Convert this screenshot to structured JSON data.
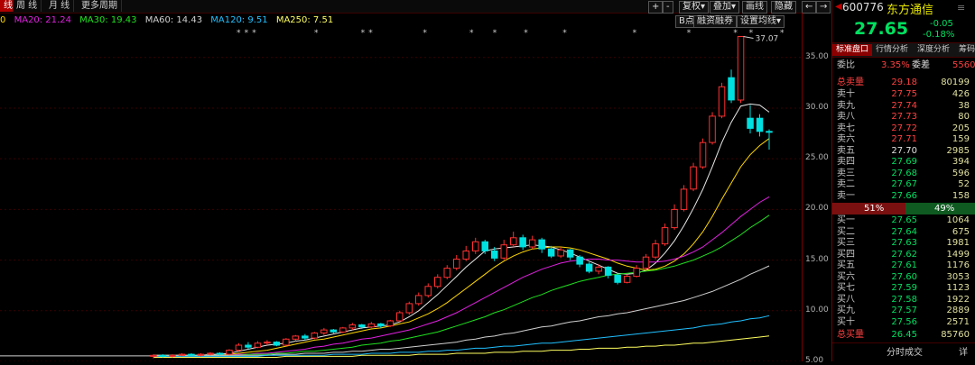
{
  "tabs": [
    "线",
    "周 线",
    "月 线",
    "更多周期"
  ],
  "toolbar": {
    "add": "+",
    "sub": "-",
    "left": "←",
    "right": "→",
    "b_point": "B点",
    "rights_label": "复权",
    "overlay_label": "叠加",
    "draw_label": "画线",
    "hide_label": "隐藏",
    "margin_label": "融资融券",
    "ma_settings_label": "设置均线"
  },
  "ma_legend": [
    {
      "label": "MA20: 21.24",
      "color": "#e020e0"
    },
    {
      "label": "MA30: 19.43",
      "color": "#20e020"
    },
    {
      "label": "MA60: 14.43",
      "color": "#d0d0d0"
    },
    {
      "label": "MA120: 9.51",
      "color": "#20c0ff"
    },
    {
      "label": "MA250: 7.51",
      "color": "#ffff60"
    }
  ],
  "ma_legend_first_visible": "0",
  "stock": {
    "code": "600776",
    "name": "东方通信",
    "price": "27.65",
    "change": "-0.05",
    "change_pct": "-0.18%"
  },
  "panel_tabs": [
    "标准盘口",
    "行情分析",
    "深度分析",
    "筹码"
  ],
  "ratio": {
    "label1": "委比",
    "value1": "3.35%",
    "label2": "委差",
    "value2": "5560"
  },
  "total_sell": {
    "label": "总卖量",
    "price": "29.18",
    "vol": "80199"
  },
  "asks": [
    {
      "label": "卖十",
      "price": "27.75",
      "vol": "426"
    },
    {
      "label": "卖九",
      "price": "27.74",
      "vol": "38"
    },
    {
      "label": "卖八",
      "price": "27.73",
      "vol": "80"
    },
    {
      "label": "卖七",
      "price": "27.72",
      "vol": "205"
    },
    {
      "label": "卖六",
      "price": "27.71",
      "vol": "159"
    },
    {
      "label": "卖五",
      "price": "27.70",
      "vol": "2985"
    },
    {
      "label": "卖四",
      "price": "27.69",
      "vol": "394"
    },
    {
      "label": "卖三",
      "price": "27.68",
      "vol": "596"
    },
    {
      "label": "卖二",
      "price": "27.67",
      "vol": "52"
    },
    {
      "label": "卖一",
      "price": "27.66",
      "vol": "158"
    }
  ],
  "ratio_bar": {
    "buy": "51%",
    "sell": "49%",
    "buy_frac": 0.51
  },
  "bids": [
    {
      "label": "买一",
      "price": "27.65",
      "vol": "1064"
    },
    {
      "label": "买二",
      "price": "27.64",
      "vol": "675"
    },
    {
      "label": "买三",
      "price": "27.63",
      "vol": "1981"
    },
    {
      "label": "买四",
      "price": "27.62",
      "vol": "1499"
    },
    {
      "label": "买五",
      "price": "27.61",
      "vol": "1176"
    },
    {
      "label": "买六",
      "price": "27.60",
      "vol": "3053"
    },
    {
      "label": "买七",
      "price": "27.59",
      "vol": "1123"
    },
    {
      "label": "买八",
      "price": "27.58",
      "vol": "1922"
    },
    {
      "label": "买九",
      "price": "27.57",
      "vol": "2889"
    },
    {
      "label": "买十",
      "price": "27.56",
      "vol": "2571"
    }
  ],
  "total_buy": {
    "label": "总买量",
    "price": "26.45",
    "vol": "85760"
  },
  "bottom_tabs": {
    "left": "分时成交",
    "right": "详"
  },
  "chart_data": {
    "type": "candlestick",
    "ylim": [
      5,
      38
    ],
    "yticks": [
      "35.00",
      "30.00",
      "25.00",
      "20.00",
      "15.00",
      "10.00",
      "5.00"
    ],
    "high_label": "37.07",
    "candles": [
      [
        5.5,
        5.6,
        5.3,
        5.7
      ],
      [
        5.6,
        5.5,
        5.4,
        5.7
      ],
      [
        5.5,
        5.6,
        5.4,
        5.7
      ],
      [
        5.6,
        5.7,
        5.5,
        5.8
      ],
      [
        5.7,
        5.6,
        5.5,
        5.8
      ],
      [
        5.6,
        5.7,
        5.5,
        5.8
      ],
      [
        5.7,
        5.8,
        5.6,
        5.9
      ],
      [
        5.8,
        5.7,
        5.6,
        5.9
      ],
      [
        5.7,
        6.1,
        5.6,
        6.2
      ],
      [
        6.1,
        6.6,
        6.0,
        6.8
      ],
      [
        6.6,
        6.4,
        6.2,
        6.9
      ],
      [
        6.4,
        6.8,
        6.3,
        7.0
      ],
      [
        6.8,
        6.9,
        6.6,
        7.1
      ],
      [
        6.9,
        6.6,
        6.5,
        7.0
      ],
      [
        6.6,
        7.2,
        6.5,
        7.3
      ],
      [
        7.2,
        7.5,
        7.0,
        7.6
      ],
      [
        7.5,
        7.3,
        7.1,
        7.7
      ],
      [
        7.3,
        7.8,
        7.2,
        7.9
      ],
      [
        7.8,
        8.1,
        7.6,
        8.3
      ],
      [
        8.1,
        7.9,
        7.7,
        8.2
      ],
      [
        7.9,
        8.3,
        7.8,
        8.4
      ],
      [
        8.3,
        8.6,
        8.1,
        8.8
      ],
      [
        8.6,
        8.4,
        8.2,
        8.7
      ],
      [
        8.4,
        8.7,
        8.3,
        8.9
      ],
      [
        8.7,
        8.5,
        8.3,
        8.8
      ],
      [
        8.5,
        9.0,
        8.4,
        9.1
      ],
      [
        9.0,
        9.8,
        8.9,
        10.0
      ],
      [
        9.8,
        10.7,
        9.6,
        10.9
      ],
      [
        10.7,
        11.5,
        10.5,
        11.8
      ],
      [
        11.5,
        12.4,
        11.3,
        12.7
      ],
      [
        12.4,
        13.3,
        12.2,
        13.6
      ],
      [
        13.3,
        14.2,
        13.1,
        14.5
      ],
      [
        14.2,
        15.1,
        14.0,
        15.5
      ],
      [
        15.1,
        15.9,
        14.9,
        16.4
      ],
      [
        15.9,
        16.8,
        15.6,
        17.2
      ],
      [
        16.8,
        15.9,
        15.6,
        17.0
      ],
      [
        15.9,
        15.2,
        14.9,
        16.3
      ],
      [
        15.2,
        16.5,
        15.0,
        17.0
      ],
      [
        16.5,
        17.2,
        16.2,
        17.8
      ],
      [
        17.2,
        16.3,
        16.0,
        17.5
      ],
      [
        16.3,
        17.0,
        16.1,
        17.4
      ],
      [
        17.0,
        16.1,
        15.7,
        17.2
      ],
      [
        16.1,
        15.4,
        15.2,
        16.4
      ],
      [
        15.4,
        16.0,
        15.2,
        16.3
      ],
      [
        16.0,
        15.3,
        15.0,
        16.1
      ],
      [
        15.3,
        14.6,
        14.3,
        15.5
      ],
      [
        14.6,
        13.9,
        13.7,
        14.8
      ],
      [
        13.9,
        14.3,
        13.6,
        14.6
      ],
      [
        14.3,
        13.5,
        13.2,
        14.4
      ],
      [
        13.5,
        12.8,
        12.6,
        13.7
      ],
      [
        12.8,
        13.4,
        12.7,
        13.6
      ],
      [
        13.4,
        14.2,
        13.3,
        14.5
      ],
      [
        14.2,
        15.3,
        14.0,
        15.6
      ],
      [
        15.3,
        16.6,
        15.1,
        17.0
      ],
      [
        16.6,
        18.2,
        16.4,
        18.6
      ],
      [
        18.2,
        20.0,
        18.0,
        20.5
      ],
      [
        20.0,
        22.0,
        19.8,
        22.4
      ],
      [
        22.0,
        24.2,
        21.8,
        24.6
      ],
      [
        24.2,
        26.6,
        24.0,
        27.0
      ],
      [
        26.6,
        29.2,
        26.4,
        29.6
      ],
      [
        29.2,
        32.1,
        29.0,
        32.5
      ],
      [
        33.0,
        30.8,
        30.5,
        33.8
      ],
      [
        30.8,
        37.07,
        30.5,
        37.07
      ],
      [
        29.0,
        28.0,
        27.5,
        30.3
      ],
      [
        29.0,
        27.7,
        27.2,
        29.4
      ],
      [
        27.7,
        27.65,
        25.9,
        27.9
      ]
    ],
    "ma_lines": [
      {
        "name": "MA5",
        "color": "#e8e8e8",
        "values": [
          5.6,
          5.6,
          5.6,
          5.6,
          5.6,
          5.6,
          5.7,
          5.7,
          5.8,
          6.0,
          6.2,
          6.4,
          6.6,
          6.7,
          6.8,
          7.0,
          7.1,
          7.3,
          7.5,
          7.7,
          7.9,
          8.1,
          8.3,
          8.4,
          8.5,
          8.6,
          8.9,
          9.4,
          10.0,
          10.8,
          11.6,
          12.5,
          13.4,
          14.3,
          15.1,
          15.9,
          16.1,
          16.2,
          16.3,
          16.4,
          16.5,
          16.4,
          16.3,
          16.0,
          15.7,
          15.3,
          14.9,
          14.5,
          14.1,
          13.7,
          13.6,
          13.7,
          14.0,
          14.7,
          15.7,
          16.9,
          18.4,
          20.1,
          22.0,
          24.2,
          26.6,
          28.6,
          30.2,
          30.4,
          30.3,
          29.6
        ]
      },
      {
        "name": "MA10",
        "color": "#ffd700",
        "values": [
          5.6,
          5.6,
          5.6,
          5.6,
          5.6,
          5.6,
          5.6,
          5.6,
          5.7,
          5.8,
          5.9,
          6.0,
          6.1,
          6.3,
          6.5,
          6.7,
          6.9,
          7.1,
          7.2,
          7.4,
          7.6,
          7.8,
          8.0,
          8.2,
          8.3,
          8.5,
          8.7,
          8.9,
          9.3,
          9.7,
          10.2,
          10.8,
          11.5,
          12.2,
          12.9,
          13.6,
          14.3,
          14.9,
          15.4,
          15.8,
          16.1,
          16.2,
          16.3,
          16.3,
          16.2,
          16.0,
          15.7,
          15.4,
          15.1,
          14.7,
          14.4,
          14.2,
          14.0,
          14.1,
          14.4,
          14.9,
          15.6,
          16.6,
          17.8,
          19.3,
          21.0,
          22.6,
          24.2,
          25.4,
          26.3,
          27.0
        ]
      },
      {
        "name": "MA20",
        "color": "#e020e0",
        "values": [
          5.6,
          5.6,
          5.6,
          5.6,
          5.6,
          5.6,
          5.6,
          5.6,
          5.6,
          5.7,
          5.7,
          5.8,
          5.8,
          5.9,
          6.0,
          6.1,
          6.2,
          6.4,
          6.5,
          6.7,
          6.8,
          7.0,
          7.2,
          7.3,
          7.5,
          7.7,
          7.9,
          8.1,
          8.4,
          8.7,
          9.0,
          9.4,
          9.8,
          10.3,
          10.8,
          11.3,
          11.8,
          12.3,
          12.8,
          13.3,
          13.7,
          14.1,
          14.4,
          14.7,
          14.9,
          15.0,
          15.1,
          15.1,
          15.0,
          15.0,
          14.9,
          14.8,
          14.8,
          14.8,
          14.9,
          15.1,
          15.4,
          15.8,
          16.3,
          17.0,
          17.7,
          18.5,
          19.3,
          20.0,
          20.7,
          21.24
        ]
      },
      {
        "name": "MA30",
        "color": "#20e020",
        "values": [
          5.6,
          5.6,
          5.6,
          5.6,
          5.6,
          5.6,
          5.6,
          5.6,
          5.6,
          5.6,
          5.7,
          5.7,
          5.7,
          5.8,
          5.8,
          5.9,
          6.0,
          6.0,
          6.1,
          6.2,
          6.3,
          6.4,
          6.6,
          6.7,
          6.8,
          7.0,
          7.1,
          7.3,
          7.5,
          7.7,
          7.9,
          8.2,
          8.5,
          8.8,
          9.1,
          9.4,
          9.8,
          10.1,
          10.5,
          10.9,
          11.3,
          11.6,
          12.0,
          12.3,
          12.6,
          12.9,
          13.1,
          13.3,
          13.5,
          13.6,
          13.7,
          13.8,
          13.9,
          14.0,
          14.2,
          14.4,
          14.7,
          15.0,
          15.4,
          15.8,
          16.3,
          16.9,
          17.5,
          18.2,
          18.8,
          19.43
        ]
      },
      {
        "name": "MA60",
        "color": "#d0d0d0",
        "values": [
          5.6,
          5.6,
          5.6,
          5.6,
          5.6,
          5.6,
          5.6,
          5.6,
          5.6,
          5.6,
          5.6,
          5.6,
          5.6,
          5.7,
          5.7,
          5.7,
          5.8,
          5.8,
          5.8,
          5.9,
          5.9,
          6.0,
          6.0,
          6.1,
          6.2,
          6.2,
          6.3,
          6.4,
          6.5,
          6.6,
          6.7,
          6.8,
          6.9,
          7.1,
          7.2,
          7.4,
          7.5,
          7.7,
          7.8,
          8.0,
          8.2,
          8.4,
          8.5,
          8.7,
          8.9,
          9.0,
          9.2,
          9.4,
          9.5,
          9.7,
          9.8,
          10.0,
          10.2,
          10.4,
          10.6,
          10.8,
          11.0,
          11.3,
          11.6,
          11.9,
          12.3,
          12.7,
          13.1,
          13.6,
          14.0,
          14.43
        ]
      },
      {
        "name": "MA120",
        "color": "#20c0ff",
        "values": [
          5.5,
          5.5,
          5.5,
          5.5,
          5.5,
          5.5,
          5.5,
          5.5,
          5.5,
          5.5,
          5.5,
          5.5,
          5.6,
          5.6,
          5.6,
          5.6,
          5.6,
          5.6,
          5.6,
          5.7,
          5.7,
          5.7,
          5.7,
          5.8,
          5.8,
          5.8,
          5.9,
          5.9,
          5.9,
          6.0,
          6.0,
          6.1,
          6.1,
          6.2,
          6.3,
          6.3,
          6.4,
          6.5,
          6.5,
          6.6,
          6.7,
          6.8,
          6.8,
          6.9,
          7.0,
          7.1,
          7.2,
          7.3,
          7.4,
          7.5,
          7.6,
          7.7,
          7.8,
          7.9,
          8.0,
          8.1,
          8.2,
          8.3,
          8.5,
          8.6,
          8.7,
          8.9,
          9.0,
          9.2,
          9.3,
          9.51
        ]
      },
      {
        "name": "MA250",
        "color": "#ffff60",
        "values": [
          5.4,
          5.4,
          5.4,
          5.4,
          5.4,
          5.4,
          5.4,
          5.4,
          5.4,
          5.4,
          5.4,
          5.4,
          5.4,
          5.4,
          5.5,
          5.5,
          5.5,
          5.5,
          5.5,
          5.5,
          5.5,
          5.5,
          5.6,
          5.6,
          5.6,
          5.6,
          5.6,
          5.6,
          5.7,
          5.7,
          5.7,
          5.7,
          5.8,
          5.8,
          5.8,
          5.8,
          5.9,
          5.9,
          5.9,
          6.0,
          6.0,
          6.0,
          6.1,
          6.1,
          6.1,
          6.2,
          6.2,
          6.3,
          6.3,
          6.3,
          6.4,
          6.4,
          6.5,
          6.5,
          6.6,
          6.6,
          6.7,
          6.8,
          6.8,
          6.9,
          7.0,
          7.1,
          7.2,
          7.3,
          7.4,
          7.51
        ]
      }
    ],
    "markers": [
      20,
      21,
      22,
      30,
      36,
      37,
      44,
      50,
      53,
      57,
      62,
      71,
      78,
      84,
      86,
      90,
      93
    ]
  }
}
